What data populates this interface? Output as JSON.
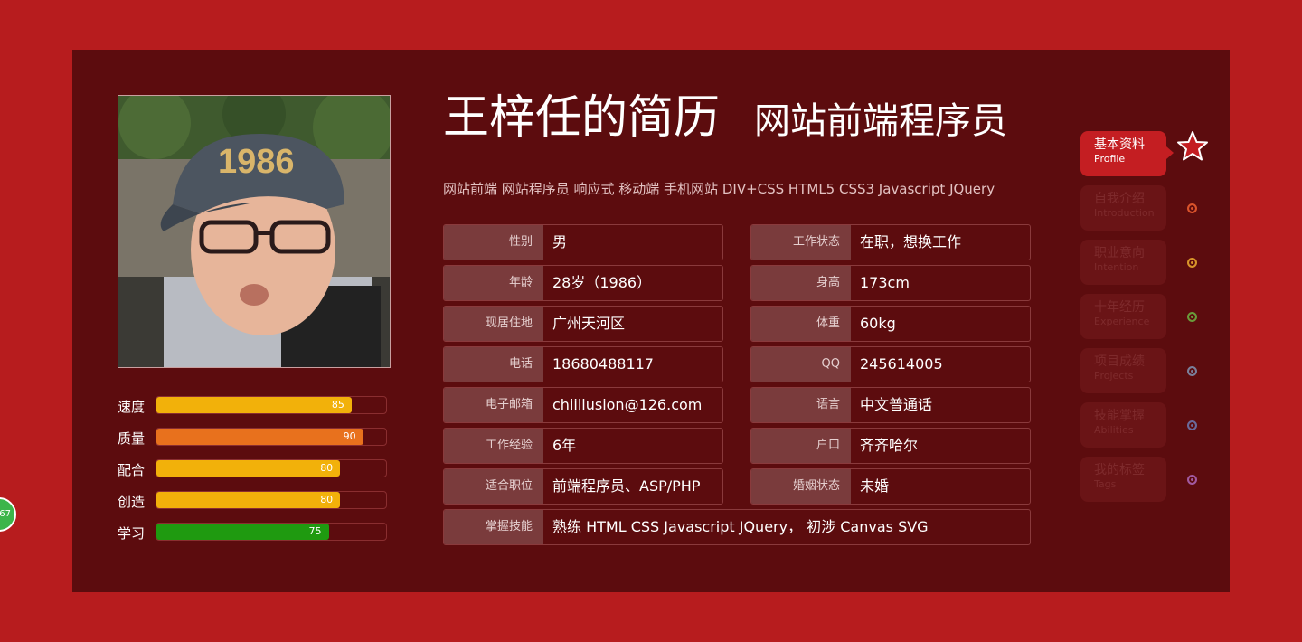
{
  "header": {
    "name": "王梓任的简历",
    "role": "网站前端程序员",
    "tags": "网站前端 网站程序员 响应式 移动端 手机网站 DIV+CSS HTML5 CSS3 Javascript JQuery"
  },
  "skills": [
    {
      "label": "速度",
      "value": "85",
      "percent": 85,
      "color": "#f2b10a"
    },
    {
      "label": "质量",
      "value": "90",
      "percent": 90,
      "color": "#e8711d"
    },
    {
      "label": "配合",
      "value": "80",
      "percent": 80,
      "color": "#f2b10a"
    },
    {
      "label": "创造",
      "value": "80",
      "percent": 80,
      "color": "#f2b10a"
    },
    {
      "label": "学习",
      "value": "75",
      "percent": 75,
      "color": "#1f9a10"
    }
  ],
  "info_left": [
    {
      "key": "性别",
      "value": "男"
    },
    {
      "key": "年龄",
      "value": "28岁（1986）"
    },
    {
      "key": "现居住地",
      "value": "广州天河区"
    },
    {
      "key": "电话",
      "value": "18680488117"
    },
    {
      "key": "电子邮箱",
      "value": "chiillusion@126.com"
    },
    {
      "key": "工作经验",
      "value": "6年"
    },
    {
      "key": "适合职位",
      "value": "前端程序员、ASP/PHP"
    }
  ],
  "info_right": [
    {
      "key": "工作状态",
      "value": "在职，想换工作"
    },
    {
      "key": "身高",
      "value": "173cm"
    },
    {
      "key": "体重",
      "value": "60kg"
    },
    {
      "key": "QQ",
      "value": "245614005"
    },
    {
      "key": "语言",
      "value": "中文普通话"
    },
    {
      "key": "户口",
      "value": "齐齐哈尔"
    },
    {
      "key": "婚姻状态",
      "value": "未婚"
    }
  ],
  "info_full": {
    "key": "掌握技能",
    "value": "熟练 HTML CSS Javascript JQuery， 初涉 Canvas SVG"
  },
  "nav": [
    {
      "zh": "基本资料",
      "en": "Profile",
      "active": true,
      "dot_color": ""
    },
    {
      "zh": "自我介绍",
      "en": "Introduction",
      "active": false,
      "dot_color": "#d9532b"
    },
    {
      "zh": "职业意向",
      "en": "Intention",
      "active": false,
      "dot_color": "#d8952a"
    },
    {
      "zh": "十年经历",
      "en": "Experience",
      "active": false,
      "dot_color": "#6a9a3a"
    },
    {
      "zh": "项目成绩",
      "en": "Projects",
      "active": false,
      "dot_color": "#7a7f9a"
    },
    {
      "zh": "技能掌握",
      "en": "Abilities",
      "active": false,
      "dot_color": "#6a6a9a"
    },
    {
      "zh": "我的标签",
      "en": "Tags",
      "active": false,
      "dot_color": "#a25aa0"
    }
  ],
  "float_badge": "67",
  "colors": {
    "page_bg": "#b71c1e",
    "card_bg": "#5c0c0e",
    "accent": "#c41e22"
  }
}
